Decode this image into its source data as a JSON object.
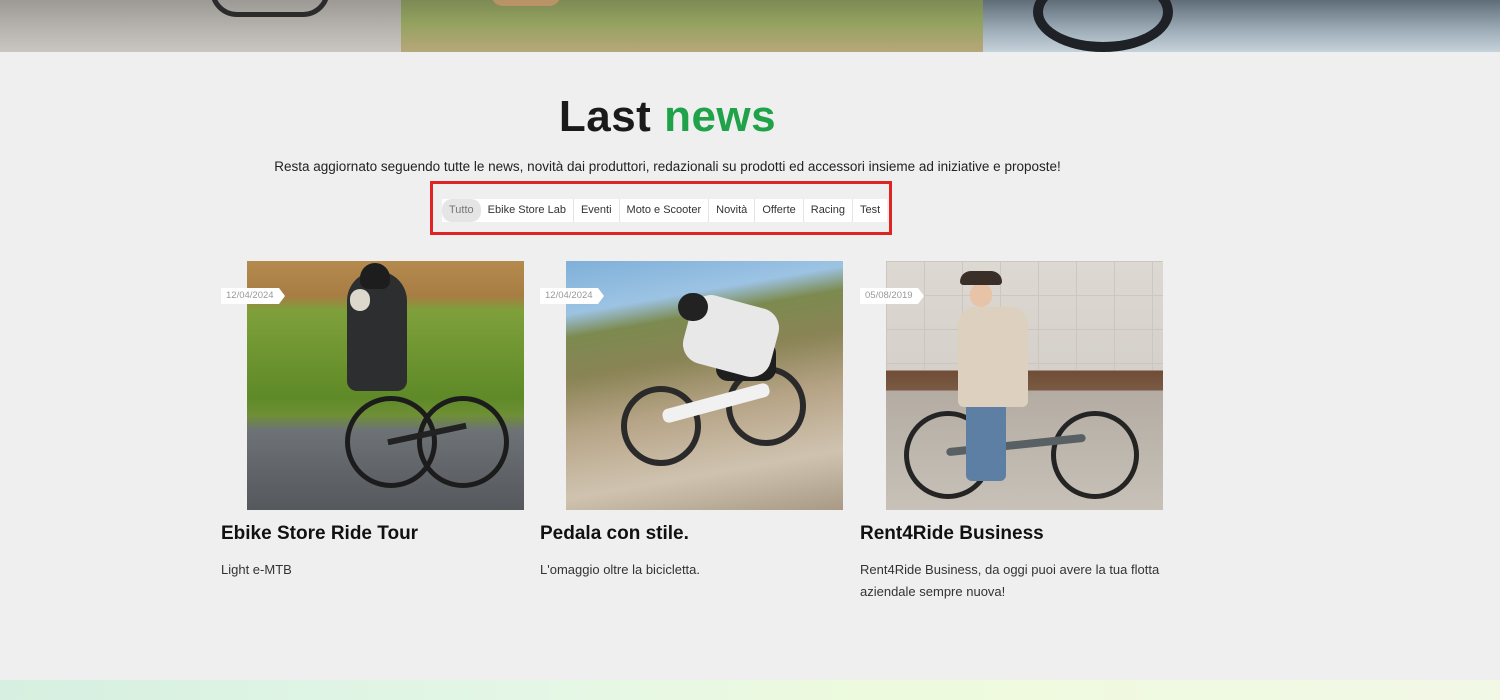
{
  "header": {
    "title_part1": "Last",
    "title_part2": "news",
    "subtitle": "Resta aggiornato seguendo tutte le news, novità dai produttori, redazionali su prodotti ed accessori insieme ad iniziative  e proposte!"
  },
  "filters": {
    "active": "Tutto",
    "items": [
      "Tutto",
      "Ebike Store Lab",
      "Eventi",
      "Moto e Scooter",
      "Novità",
      "Offerte",
      "Racing",
      "Test"
    ]
  },
  "colors": {
    "accent": "#1fa24a",
    "highlight_border": "#e02424",
    "background": "#efefef"
  },
  "articles": [
    {
      "date": "12/04/2024",
      "title": "Ebike Store Ride Tour",
      "description": "Light e-MTB",
      "image": "road-cyclist-photo"
    },
    {
      "date": "12/04/2024",
      "title": "Pedala con stile.",
      "description": "L'omaggio oltre la bicicletta.",
      "image": "mountain-biker-photo"
    },
    {
      "date": "05/08/2019",
      "title": "Rent4Ride Business",
      "description": "Rent4Ride Business, da oggi puoi avere la tua flotta aziendale sempre nuova!",
      "image": "woman-city-bike-photo"
    }
  ]
}
